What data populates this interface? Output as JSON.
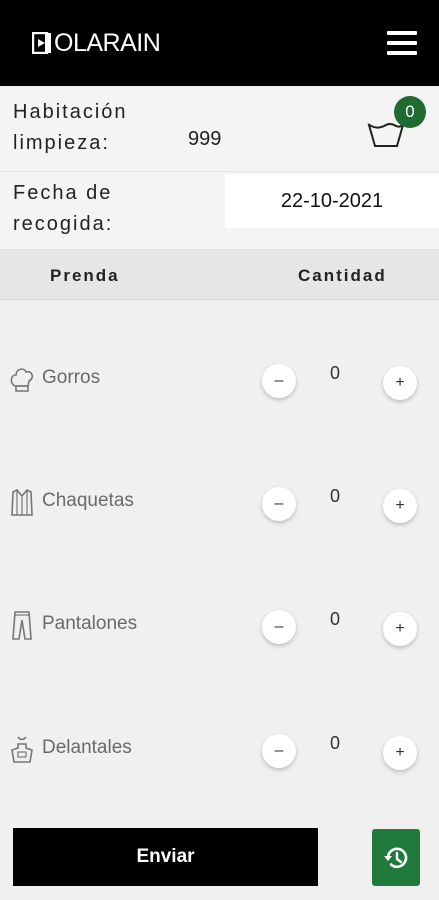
{
  "header": {
    "brand_text": "OLARAIN",
    "menu_icon": "hamburger-menu-icon"
  },
  "room": {
    "label": "Habitación\nlimpieza:",
    "value": "999"
  },
  "cart": {
    "icon": "laundry-basket-icon",
    "count": "0"
  },
  "pickup": {
    "label": "Fecha de\nrecogida:",
    "date": "22-10-2021"
  },
  "table": {
    "col_item": "Prenda",
    "col_qty": "Cantidad"
  },
  "items": [
    {
      "label": "Gorros",
      "icon": "chef-hat-icon",
      "qty": "0",
      "minus": "–",
      "plus": "+"
    },
    {
      "label": "Chaquetas",
      "icon": "jacket-icon",
      "qty": "0",
      "minus": "–",
      "plus": "+"
    },
    {
      "label": "Pantalones",
      "icon": "pants-icon",
      "qty": "0",
      "minus": "–",
      "plus": "+"
    },
    {
      "label": "Delantales",
      "icon": "apron-icon",
      "qty": "0",
      "minus": "–",
      "plus": "+"
    }
  ],
  "actions": {
    "send_label": "Enviar",
    "history_icon": "history-icon"
  },
  "colors": {
    "accent_green": "#1f7a3c",
    "badge_green": "#1f6b31",
    "bar_black": "#000000"
  }
}
